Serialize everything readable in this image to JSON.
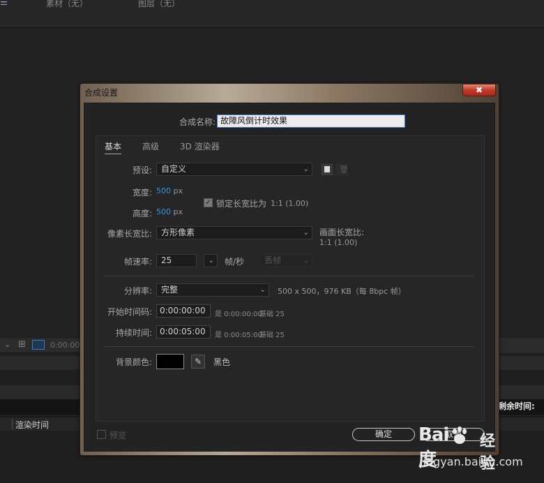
{
  "background": {
    "menu_tab": "☰",
    "material_tab": "素材（无）",
    "layer_tab": "图层（无）",
    "timeline_timecode": "0:00:00",
    "remaining_time_label": "剩余时间:",
    "render_time_label": "渲染时间"
  },
  "dialog": {
    "title": "合成设置",
    "close_icon": "✖",
    "comp_name_label": "合成名称:",
    "comp_name_value": "故障风倒计时效果",
    "tabs": [
      "基本",
      "高级",
      "3D 渲染器"
    ],
    "preset_label": "预设:",
    "preset_value": "自定义",
    "width_label": "宽度:",
    "width_value": "500",
    "height_label": "高度:",
    "height_value": "500",
    "unit_px": "px",
    "lock_aspect_label": "锁定长宽比为",
    "lock_aspect_value": "1:1 (1.00)",
    "pixel_aspect_label": "像素长宽比:",
    "pixel_aspect_value": "方形像素",
    "frame_aspect_label": "画面长宽比:",
    "frame_aspect_value": "1:1 (1.00)",
    "frame_rate_label": "帧速率:",
    "frame_rate_value": "25",
    "frame_rate_unit": "帧/秒",
    "drop_frame_value": "丢帧",
    "resolution_label": "分辨率:",
    "resolution_value": "完整",
    "resolution_info": "500 x 500，976 KB（每 8bpc 帧）",
    "start_tc_label": "开始时间码:",
    "start_tc_value": "0:00:00:00",
    "start_tc_info": "是 0:00:00:00",
    "start_tc_base": "基础 25",
    "duration_label": "持续时间:",
    "duration_value": "0:00:05:00",
    "duration_info": "是 0:00:05:00",
    "duration_base": "基础 25",
    "bg_color_label": "背景颜色:",
    "bg_color_name": "黑色",
    "bg_color_hex": "#000000",
    "preview_label": "预览",
    "ok_label": "确定",
    "cancel_label": "取消"
  },
  "watermark": {
    "logo": "Bai度",
    "cn_text": "经验",
    "url": "jingyan.baidu.com"
  },
  "colors": {
    "accent_blue": "#3c8ede",
    "close_red": "#c0392b"
  }
}
